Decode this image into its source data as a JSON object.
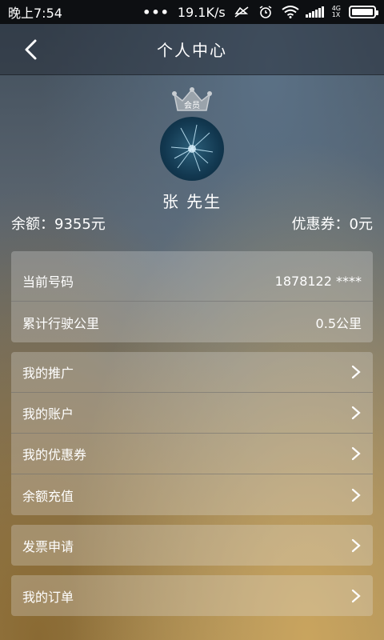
{
  "status_bar": {
    "time": "晚上7:54",
    "dots": "•••",
    "speed": "19.1K/s",
    "network": [
      "4G",
      "1X"
    ]
  },
  "header": {
    "title": "个人中心"
  },
  "profile": {
    "badge": "会员",
    "name": "张  先生"
  },
  "summary": {
    "balance": "余额：9355元",
    "coupons": "优惠券：0元"
  },
  "info": [
    {
      "label": "当前号码",
      "value": "1878122 ****"
    },
    {
      "label": "累计行驶公里",
      "value": "0.5公里"
    }
  ],
  "menu_group_1": [
    {
      "label": "我的推广"
    },
    {
      "label": "我的账户"
    },
    {
      "label": "我的优惠券"
    },
    {
      "label": "余额充值"
    }
  ],
  "menu_group_2": [
    {
      "label": "发票申请"
    }
  ],
  "menu_group_3": [
    {
      "label": "我的订单"
    }
  ]
}
